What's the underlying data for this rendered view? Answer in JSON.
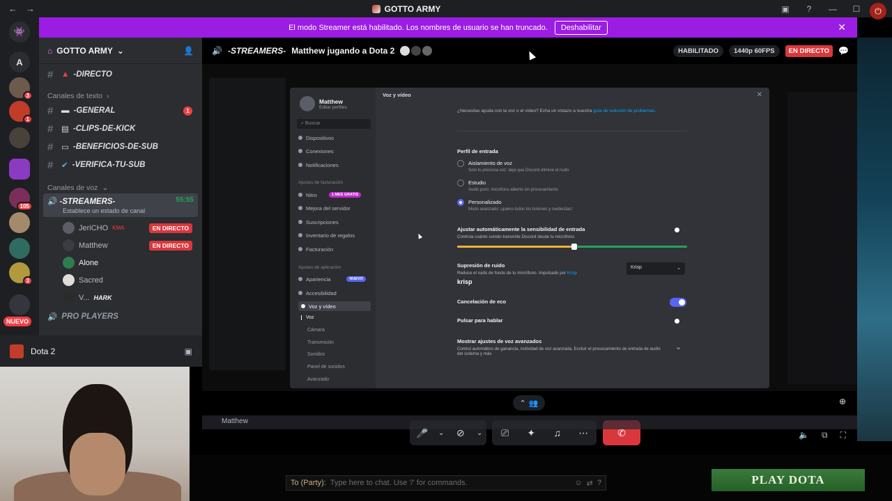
{
  "window": {
    "title": "GOTTO ARMY"
  },
  "banner": {
    "text": "El modo Streamer está habilitado. Los nombres de usuario se han truncado.",
    "button": "Deshabilitar"
  },
  "rail": {
    "top_letter": "A",
    "badges": [
      "3",
      "1",
      "105",
      "3"
    ],
    "nuevo": "NUEVO"
  },
  "server": {
    "name": "GOTTO ARMY"
  },
  "sidebar": {
    "top_channel": "-DIRECTO",
    "text_category": "Canales de texto",
    "text_channels": [
      {
        "name": "-GENERAL",
        "unread": "1"
      },
      {
        "name": "-CLIPS-DE-KICK"
      },
      {
        "name": "-BENEFICIOS-DE-SUB"
      },
      {
        "name": "-VERIFICA-TU-SUB"
      }
    ],
    "voice_category": "Canales de voz",
    "voice_channel": {
      "name": "-STREAMERS-",
      "timer": "55:55",
      "status": "Establece un estado de canal"
    },
    "voice_users": [
      {
        "name": "JeriCHO",
        "extra": "KMA",
        "live": "EN DIRECTO"
      },
      {
        "name": "Matthew",
        "live": "EN DIRECTO"
      },
      {
        "name": "Alone"
      },
      {
        "name": "Sacred"
      },
      {
        "name": "V...",
        "extra": "HARK"
      }
    ],
    "next_channel": "PRO PLAYERS",
    "activity": "Dota 2"
  },
  "stream_header": {
    "channel": "-STREAMERS-",
    "title": "Matthew jugando a Dota 2",
    "enabled": "HABILITADO",
    "quality": "1440p 60FPS",
    "live": "EN DIRECTO"
  },
  "settings": {
    "user": "Matthew",
    "edit_profile": "Editar perfiles",
    "search_placeholder": "Buscar",
    "items_top": [
      "Dispositivos",
      "Conexiones",
      "Notificaciones"
    ],
    "billing_category": "Ajustes de facturación",
    "billing_items": [
      "Nitro",
      "Mejora del servidor",
      "Suscripciones",
      "Inventario de regalos",
      "Facturación"
    ],
    "nitro_badge": "1 MES GRATIS",
    "app_category": "Ajustes de aplicación",
    "app_items": [
      "Apariencia",
      "Accesibilidad",
      "Voz y vídeo"
    ],
    "new_badge": "NUEVO",
    "sub_items": [
      "Voz",
      "Cámara",
      "Transmisión",
      "Sonidos",
      "Panel de sonidos",
      "Avanzado"
    ],
    "page_title": "Voz y vídeo",
    "help_text": "¿Necesitas ayuda con la voz o el vídeo? Echa un vistazo a nuestra",
    "help_link": "guía de solución de problemas.",
    "input_profile": {
      "title": "Perfil de entrada",
      "options": [
        {
          "label": "Aislamiento de voz",
          "desc": "Solo tu preciosa voz: deja que Discord elimine el ruido",
          "selected": false
        },
        {
          "label": "Estudio",
          "desc": "Audio puro: micrófono abierto sin procesamiento",
          "selected": false
        },
        {
          "label": "Personalizado",
          "desc": "Modo avanzado: ¡quiero todos los botones y ruedecitas!",
          "selected": true
        }
      ]
    },
    "auto_sensitivity": {
      "title": "Ajustar automáticamente la sensibilidad de entrada",
      "desc": "Controla cuánto sonido transmite Discord desde tu micrófono.",
      "enabled": false,
      "level": 0.51
    },
    "noise": {
      "title": "Supresión de ruido",
      "desc": "Reduce el ruido de fondo de tu micrófono. Impulsado por",
      "desc_link": "Krisp",
      "select": "Krisp",
      "logo": "krisp"
    },
    "echo": {
      "title": "Cancelación de eco",
      "enabled": true
    },
    "ptt": {
      "title": "Pulsar para hablar",
      "enabled": false
    },
    "advanced": {
      "title": "Mostrar ajustes de voz avanzados",
      "desc": "Control automático de ganancia, Actividad de voz avanzada, Excluir el procesamiento de entrada de audio del sistema y más"
    }
  },
  "taskbar": {
    "name": "Matthew"
  },
  "chat": {
    "to": "To (Party):",
    "placeholder": "Type here to chat. Use '/' for commands."
  },
  "play_button": "PLAY DOTA",
  "colors": {
    "accent": "#5865f2",
    "banner": "#9b1de3",
    "live": "#da373c",
    "online": "#23a55a"
  }
}
